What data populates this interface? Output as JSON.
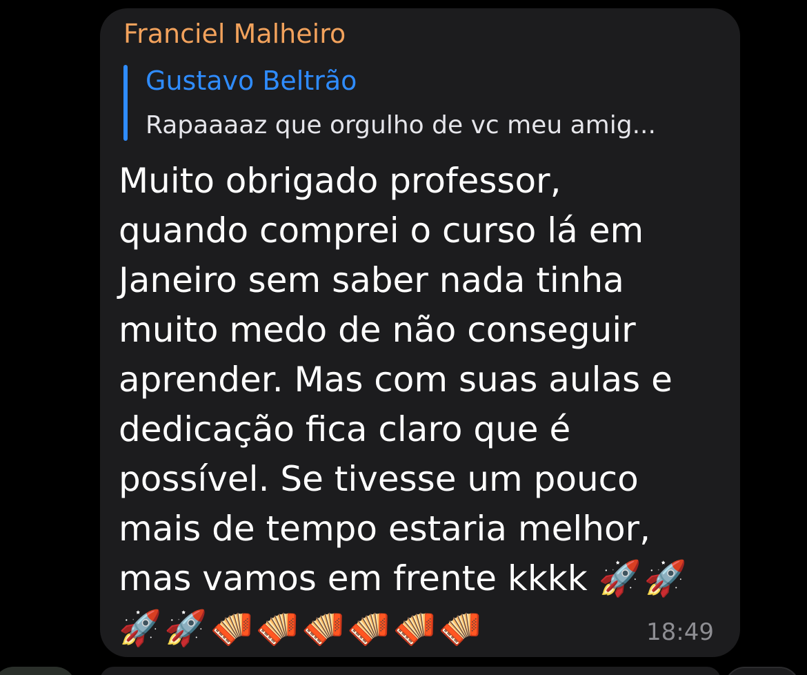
{
  "message": {
    "sender_name": "Franciel Malheiro",
    "reply": {
      "author": "Gustavo Beltrão",
      "preview": "Rapaaaaz que orgulho de vc meu amig..."
    },
    "text": "Muito obrigado professor,\nquando comprei o curso lá em\nJaneiro sem saber nada tinha\nmuito medo de não conseguir\naprender. Mas com suas aulas e\ndedicação fica claro que é\npossível. Se tivesse um pouco\nmais de tempo estaria melhor,\nmas vamos em frente kkkk ",
    "emoji_inline": "🚀🚀",
    "emoji_line": "🚀🚀🪗🪗🪗🪗🪗🪗",
    "time": "18:49"
  },
  "colors": {
    "background": "#000000",
    "bubble": "#1c1c1e",
    "sender_name": "#f2a25c",
    "reply_author": "#2f8cff",
    "reply_bar": "#2f8cff",
    "reply_text": "#e5e5ea",
    "body_text": "#ffffff",
    "time": "#8e8e93"
  },
  "icons": {
    "rocket": "rocket-emoji",
    "accordion": "accordion-emoji"
  }
}
